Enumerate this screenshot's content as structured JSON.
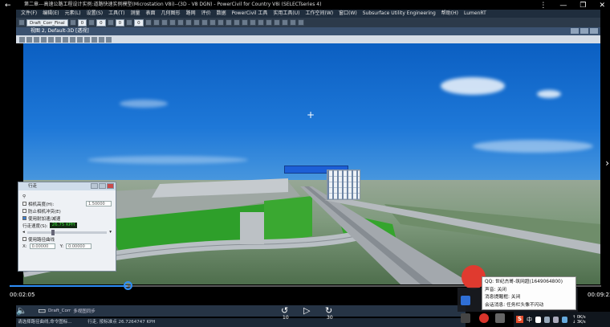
{
  "window": {
    "title": "第二章---高速公路工程设计实例:道路快速实例模型(Microstation V8i)--(3D - V8 DGN) - PowerCivil for Country V8i (SELECTseries 4)",
    "controls": [
      "⋮",
      "—",
      "❐",
      "✕"
    ]
  },
  "menu": {
    "items": [
      "文件(F)",
      "编辑(E)",
      "元素(L)",
      "设置(S)",
      "工具(T)",
      "测量",
      "表面",
      "几何图形",
      "路网",
      "评价",
      "数据",
      "PowerCivil 工具",
      "实用工具(U)",
      "工作空间(W)",
      "窗口(W)",
      "Subsurface Utility Engineering",
      "帮助(H)",
      "LumenRT"
    ]
  },
  "toolbar": {
    "level_select": "Draft_Corr_Final",
    "num_a": "0",
    "num_b": "0",
    "num_c": "0",
    "num_d": "0"
  },
  "view": {
    "title": "视图 2, Default-3D [透视]"
  },
  "walk_dialog": {
    "title": "行走",
    "options": [
      {
        "label": "相机高度(H):",
        "checked": false,
        "value": "1.50000"
      },
      {
        "label": "防止相机冲突(E)",
        "checked": false
      },
      {
        "label": "使用耐加速/减速",
        "checked": true
      }
    ],
    "speed_label": "行走速度(S):",
    "speed_value": "26.75 KPH",
    "path_label": "使用路径曲线",
    "x_label": "X:",
    "x_value": "0.00000",
    "y_label": "Y:",
    "y_value": "0.00000"
  },
  "player": {
    "time_current": "00:02:05",
    "time_total": "00:09:23",
    "progress_fraction": 0.2,
    "skip_back": "10",
    "skip_forward": "30"
  },
  "status": {
    "left": "请选择路径曲线,命令图标...",
    "view": "Draft_Corr",
    "zoom_hint": "多视图同步",
    "walk": "行走, 按标准点 26.7264747 KPH"
  },
  "tooltip": {
    "qq": "QQ: 世纪杰哥-筑网超(1649064800)",
    "sound": "声音: 关闭",
    "reminder": "消息提醒框: 关闭",
    "session": "会话消息: 任务栏头像不闪动"
  },
  "taskbar": {
    "ime": "S",
    "ime_lang": "中",
    "net_up": "↑ 0K/s",
    "net_down": "↓ 3K/s"
  },
  "colors": {
    "accent": "#2e8ef7",
    "sky_top": "#0b5fc2",
    "building_blue": "#1d5fd6",
    "grass": "#2e9f2a",
    "speed_text": "#3ae43a",
    "brand_red": "#e03a2f"
  }
}
